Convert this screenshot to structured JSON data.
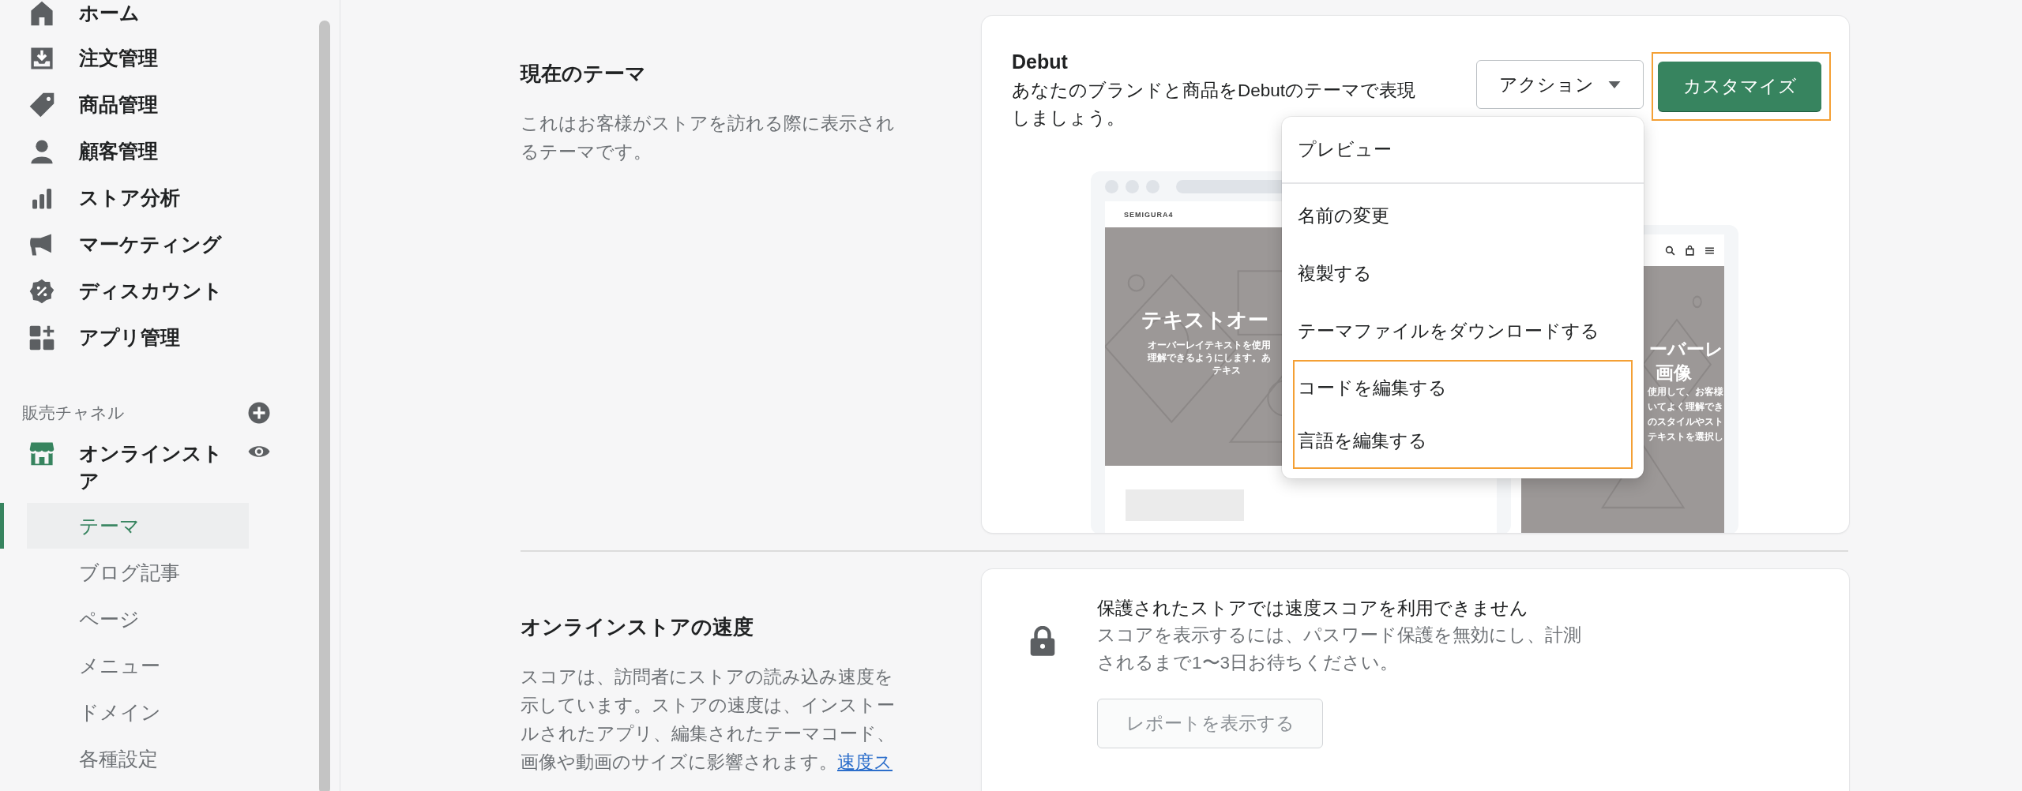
{
  "sidebar": {
    "nav": [
      {
        "label": "ホーム"
      },
      {
        "label": "注文管理"
      },
      {
        "label": "商品管理"
      },
      {
        "label": "顧客管理"
      },
      {
        "label": "ストア分析"
      },
      {
        "label": "マーケティング"
      },
      {
        "label": "ディスカウント"
      },
      {
        "label": "アプリ管理"
      }
    ],
    "channels_heading": "販売チャネル",
    "channel": {
      "label": "オンラインストア",
      "children": [
        {
          "label": "テーマ",
          "selected": true
        },
        {
          "label": "ブログ記事",
          "selected": false
        },
        {
          "label": "ページ",
          "selected": false
        },
        {
          "label": "メニュー",
          "selected": false
        },
        {
          "label": "ドメイン",
          "selected": false
        },
        {
          "label": "各種設定",
          "selected": false
        }
      ]
    }
  },
  "current_theme": {
    "heading": "現在のテーマ",
    "description": "これはお客様がストアを訪れる際に表示されるテーマです。",
    "card": {
      "title": "Debut",
      "description": "あなたのブランドと商品をDebutのテーマで表現しましょう。",
      "actions_button": "アクション",
      "customize_button": "カスタマイズ",
      "menu": [
        {
          "label": "プレビュー",
          "highlighted": false
        },
        {
          "label": "名前の変更",
          "highlighted": false
        },
        {
          "label": "複製する",
          "highlighted": false
        },
        {
          "label": "テーマファイルをダウンロードする",
          "highlighted": false
        },
        {
          "label": "コードを編集する",
          "highlighted": true
        },
        {
          "label": "言語を編集する",
          "highlighted": true
        }
      ],
      "preview": {
        "store_name": "SEMIGURA4",
        "desktop_heading": "テキストオー",
        "desktop_lines": [
          "オーバーレイテキストを使用",
          "理解できるようにします。あ",
          "テキス"
        ],
        "mobile_heading": [
          "ーバーレ",
          "画像"
        ],
        "mobile_lines": [
          "使用して、お客様",
          "いてよく理解でき",
          "のスタイルやスト",
          "テキストを選択し"
        ]
      }
    }
  },
  "speed": {
    "heading": "オンラインストアの速度",
    "description": "スコアは、訪問者にストアの読み込み速度を示しています。ストアの速度は、インストールされたアプリ、編集されたテーマコード、画像や動画のサイズに影響されます。",
    "link": "速度ス",
    "card": {
      "title": "保護されたストアでは速度スコアを利用できません",
      "description": "スコアを表示するには、パスワード保護を無効にし、計測されるまで1〜3日お待ちください。",
      "button": "レポートを表示する"
    }
  }
}
